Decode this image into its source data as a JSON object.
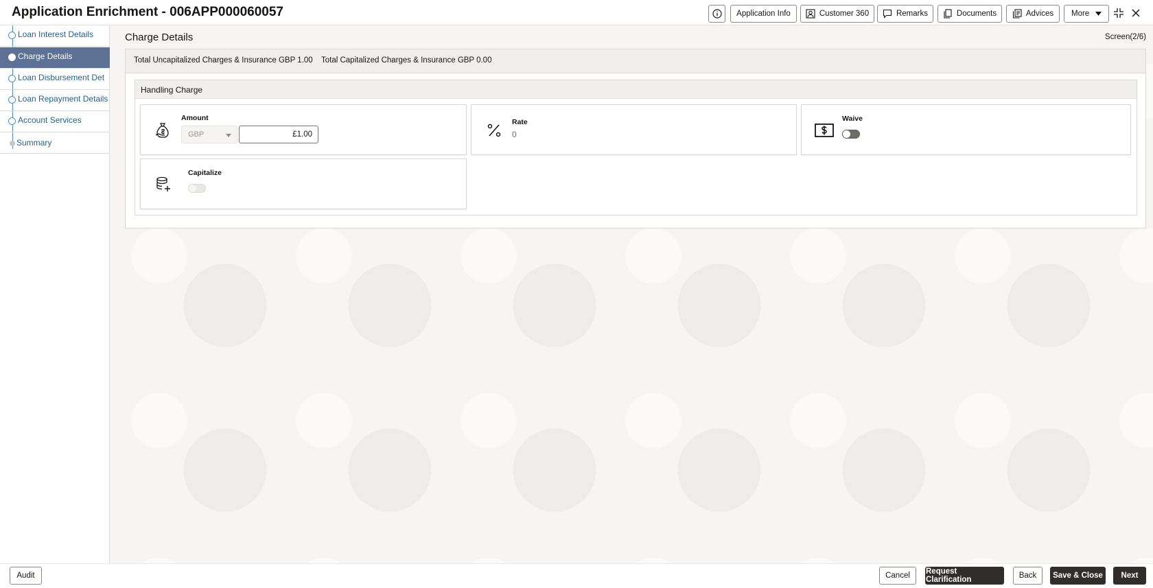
{
  "header": {
    "title": "Application Enrichment - 006APP000060057",
    "buttons": {
      "application_info": "Application Info",
      "customer_360": "Customer 360",
      "remarks": "Remarks",
      "documents": "Documents",
      "advices": "Advices",
      "more": "More"
    }
  },
  "sidebar": {
    "items": [
      {
        "label": "Loan Interest Details",
        "state": "completed"
      },
      {
        "label": "Charge Details",
        "state": "active"
      },
      {
        "label": "Loan Disbursement Det",
        "state": "completed"
      },
      {
        "label": "Loan Repayment Details",
        "state": "completed"
      },
      {
        "label": "Account Services",
        "state": "completed"
      },
      {
        "label": "Summary",
        "state": "pending"
      }
    ]
  },
  "main": {
    "page_title": "Charge Details",
    "screen_indicator": "Screen(2/6)",
    "totals": {
      "uncapitalized_label": "Total Uncapitalized Charges & Insurance",
      "uncapitalized_value": "GBP 1.00",
      "capitalized_label": "Total Capitalized Charges & Insurance",
      "capitalized_value": "GBP 0.00"
    },
    "charge": {
      "name": "Handling Charge",
      "amount_label": "Amount",
      "currency": "GBP",
      "amount_value": "£1.00",
      "rate_label": "Rate",
      "rate_value": "0",
      "waive_label": "Waive",
      "capitalize_label": "Capitalize"
    }
  },
  "footer": {
    "audit": "Audit",
    "cancel": "Cancel",
    "request_clarification": "Request Clarification",
    "back": "Back",
    "save_close": "Save & Close",
    "next": "Next"
  },
  "colors": {
    "sidebar_active_bg": "#5c7194",
    "link_blue": "#21638f",
    "primary_button_bg": "#312d2a"
  }
}
